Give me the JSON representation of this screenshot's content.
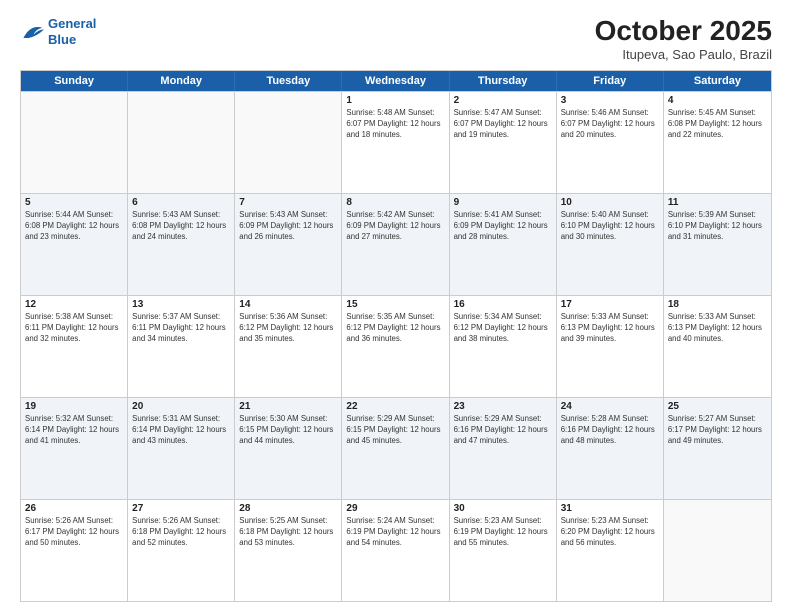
{
  "logo": {
    "line1": "General",
    "line2": "Blue"
  },
  "title": "October 2025",
  "subtitle": "Itupeva, Sao Paulo, Brazil",
  "days": [
    "Sunday",
    "Monday",
    "Tuesday",
    "Wednesday",
    "Thursday",
    "Friday",
    "Saturday"
  ],
  "weeks": [
    [
      {
        "date": "",
        "info": ""
      },
      {
        "date": "",
        "info": ""
      },
      {
        "date": "",
        "info": ""
      },
      {
        "date": "1",
        "info": "Sunrise: 5:48 AM\nSunset: 6:07 PM\nDaylight: 12 hours\nand 18 minutes."
      },
      {
        "date": "2",
        "info": "Sunrise: 5:47 AM\nSunset: 6:07 PM\nDaylight: 12 hours\nand 19 minutes."
      },
      {
        "date": "3",
        "info": "Sunrise: 5:46 AM\nSunset: 6:07 PM\nDaylight: 12 hours\nand 20 minutes."
      },
      {
        "date": "4",
        "info": "Sunrise: 5:45 AM\nSunset: 6:08 PM\nDaylight: 12 hours\nand 22 minutes."
      }
    ],
    [
      {
        "date": "5",
        "info": "Sunrise: 5:44 AM\nSunset: 6:08 PM\nDaylight: 12 hours\nand 23 minutes."
      },
      {
        "date": "6",
        "info": "Sunrise: 5:43 AM\nSunset: 6:08 PM\nDaylight: 12 hours\nand 24 minutes."
      },
      {
        "date": "7",
        "info": "Sunrise: 5:43 AM\nSunset: 6:09 PM\nDaylight: 12 hours\nand 26 minutes."
      },
      {
        "date": "8",
        "info": "Sunrise: 5:42 AM\nSunset: 6:09 PM\nDaylight: 12 hours\nand 27 minutes."
      },
      {
        "date": "9",
        "info": "Sunrise: 5:41 AM\nSunset: 6:09 PM\nDaylight: 12 hours\nand 28 minutes."
      },
      {
        "date": "10",
        "info": "Sunrise: 5:40 AM\nSunset: 6:10 PM\nDaylight: 12 hours\nand 30 minutes."
      },
      {
        "date": "11",
        "info": "Sunrise: 5:39 AM\nSunset: 6:10 PM\nDaylight: 12 hours\nand 31 minutes."
      }
    ],
    [
      {
        "date": "12",
        "info": "Sunrise: 5:38 AM\nSunset: 6:11 PM\nDaylight: 12 hours\nand 32 minutes."
      },
      {
        "date": "13",
        "info": "Sunrise: 5:37 AM\nSunset: 6:11 PM\nDaylight: 12 hours\nand 34 minutes."
      },
      {
        "date": "14",
        "info": "Sunrise: 5:36 AM\nSunset: 6:12 PM\nDaylight: 12 hours\nand 35 minutes."
      },
      {
        "date": "15",
        "info": "Sunrise: 5:35 AM\nSunset: 6:12 PM\nDaylight: 12 hours\nand 36 minutes."
      },
      {
        "date": "16",
        "info": "Sunrise: 5:34 AM\nSunset: 6:12 PM\nDaylight: 12 hours\nand 38 minutes."
      },
      {
        "date": "17",
        "info": "Sunrise: 5:33 AM\nSunset: 6:13 PM\nDaylight: 12 hours\nand 39 minutes."
      },
      {
        "date": "18",
        "info": "Sunrise: 5:33 AM\nSunset: 6:13 PM\nDaylight: 12 hours\nand 40 minutes."
      }
    ],
    [
      {
        "date": "19",
        "info": "Sunrise: 5:32 AM\nSunset: 6:14 PM\nDaylight: 12 hours\nand 41 minutes."
      },
      {
        "date": "20",
        "info": "Sunrise: 5:31 AM\nSunset: 6:14 PM\nDaylight: 12 hours\nand 43 minutes."
      },
      {
        "date": "21",
        "info": "Sunrise: 5:30 AM\nSunset: 6:15 PM\nDaylight: 12 hours\nand 44 minutes."
      },
      {
        "date": "22",
        "info": "Sunrise: 5:29 AM\nSunset: 6:15 PM\nDaylight: 12 hours\nand 45 minutes."
      },
      {
        "date": "23",
        "info": "Sunrise: 5:29 AM\nSunset: 6:16 PM\nDaylight: 12 hours\nand 47 minutes."
      },
      {
        "date": "24",
        "info": "Sunrise: 5:28 AM\nSunset: 6:16 PM\nDaylight: 12 hours\nand 48 minutes."
      },
      {
        "date": "25",
        "info": "Sunrise: 5:27 AM\nSunset: 6:17 PM\nDaylight: 12 hours\nand 49 minutes."
      }
    ],
    [
      {
        "date": "26",
        "info": "Sunrise: 5:26 AM\nSunset: 6:17 PM\nDaylight: 12 hours\nand 50 minutes."
      },
      {
        "date": "27",
        "info": "Sunrise: 5:26 AM\nSunset: 6:18 PM\nDaylight: 12 hours\nand 52 minutes."
      },
      {
        "date": "28",
        "info": "Sunrise: 5:25 AM\nSunset: 6:18 PM\nDaylight: 12 hours\nand 53 minutes."
      },
      {
        "date": "29",
        "info": "Sunrise: 5:24 AM\nSunset: 6:19 PM\nDaylight: 12 hours\nand 54 minutes."
      },
      {
        "date": "30",
        "info": "Sunrise: 5:23 AM\nSunset: 6:19 PM\nDaylight: 12 hours\nand 55 minutes."
      },
      {
        "date": "31",
        "info": "Sunrise: 5:23 AM\nSunset: 6:20 PM\nDaylight: 12 hours\nand 56 minutes."
      },
      {
        "date": "",
        "info": ""
      }
    ]
  ]
}
